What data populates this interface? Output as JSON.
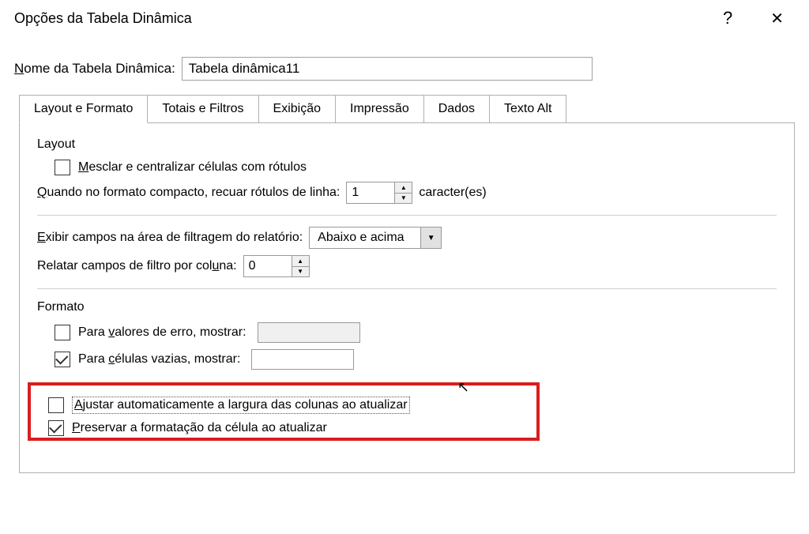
{
  "dialog": {
    "title": "Opções da Tabela Dinâmica",
    "help_symbol": "?",
    "close_symbol": "✕"
  },
  "name_field": {
    "label_pre": "N",
    "label_post": "ome da Tabela Dinâmica:",
    "value": "Tabela dinâmica11"
  },
  "tabs": [
    {
      "label": "Layout e Formato",
      "active": true
    },
    {
      "label": "Totais e Filtros",
      "active": false
    },
    {
      "label": "Exibição",
      "active": false
    },
    {
      "label": "Impressão",
      "active": false
    },
    {
      "label": "Dados",
      "active": false
    },
    {
      "label": "Texto Alt",
      "active": false
    }
  ],
  "layout_section": {
    "title": "Layout",
    "merge_label_pre": "M",
    "merge_label_post": "esclar e centralizar células com rótulos",
    "merge_checked": false,
    "indent_label_pre": "Q",
    "indent_label_post": "uando no formato compacto, recuar rótulos de linha:",
    "indent_value": "1",
    "indent_suffix": "caracter(es)",
    "filter_area_label_pre": "E",
    "filter_area_label_post": "xibir campos na área de filtragem do relatório:",
    "filter_area_value": "Abaixo e acima",
    "filter_count_label_pre": "Relatar campos de filtro por col",
    "filter_count_label_u": "u",
    "filter_count_label_post": "na:",
    "filter_count_value": "0"
  },
  "format_section": {
    "title": "Formato",
    "error_label_pre": "Para ",
    "error_label_u": "v",
    "error_label_post": "alores de erro, mostrar:",
    "error_checked": false,
    "empty_label_pre": "Para ",
    "empty_label_u": "c",
    "empty_label_post": "élulas vazias, mostrar:",
    "empty_checked": true,
    "autofit_label_pre": "A",
    "autofit_label_post": "justar automaticamente a largura das colunas ao atualizar",
    "autofit_checked": false,
    "preserve_label_pre": "P",
    "preserve_label_post": "reservar a formatação da célula ao atualizar",
    "preserve_checked": true
  }
}
